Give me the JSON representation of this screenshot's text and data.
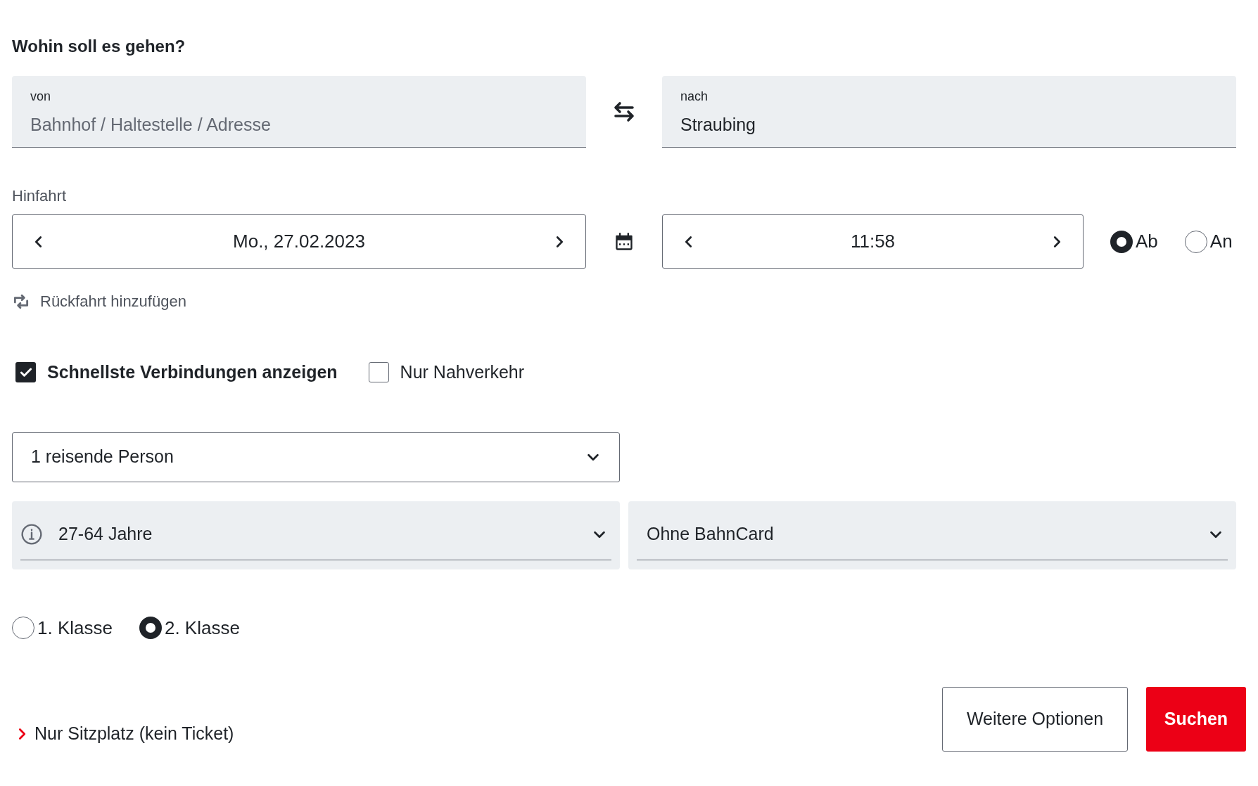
{
  "heading": "Wohin soll es gehen?",
  "from": {
    "label": "von",
    "placeholder": "Bahnhof / Haltestelle / Adresse"
  },
  "to": {
    "label": "nach",
    "value": "Straubing"
  },
  "outbound": {
    "label": "Hinfahrt",
    "date": "Mo., 27.02.2023",
    "time": "11:58"
  },
  "time_mode": [
    {
      "label": "Ab",
      "selected": true
    },
    {
      "label": "An",
      "selected": false
    }
  ],
  "return_link": "Rückfahrt hinzufügen",
  "options": [
    {
      "label": "Schnellste Verbindungen anzeigen",
      "checked": true
    },
    {
      "label": "Nur Nahverkehr",
      "checked": false
    }
  ],
  "travellers": "1 reisende Person",
  "age": "27-64 Jahre",
  "bahncard": "Ohne BahnCard",
  "classes": [
    {
      "label": "1. Klasse",
      "selected": false
    },
    {
      "label": "2. Klasse",
      "selected": true
    }
  ],
  "seat_link": "Nur Sitzplatz (kein Ticket)",
  "buttons": {
    "more": "Weitere Optionen",
    "search": "Suchen"
  }
}
